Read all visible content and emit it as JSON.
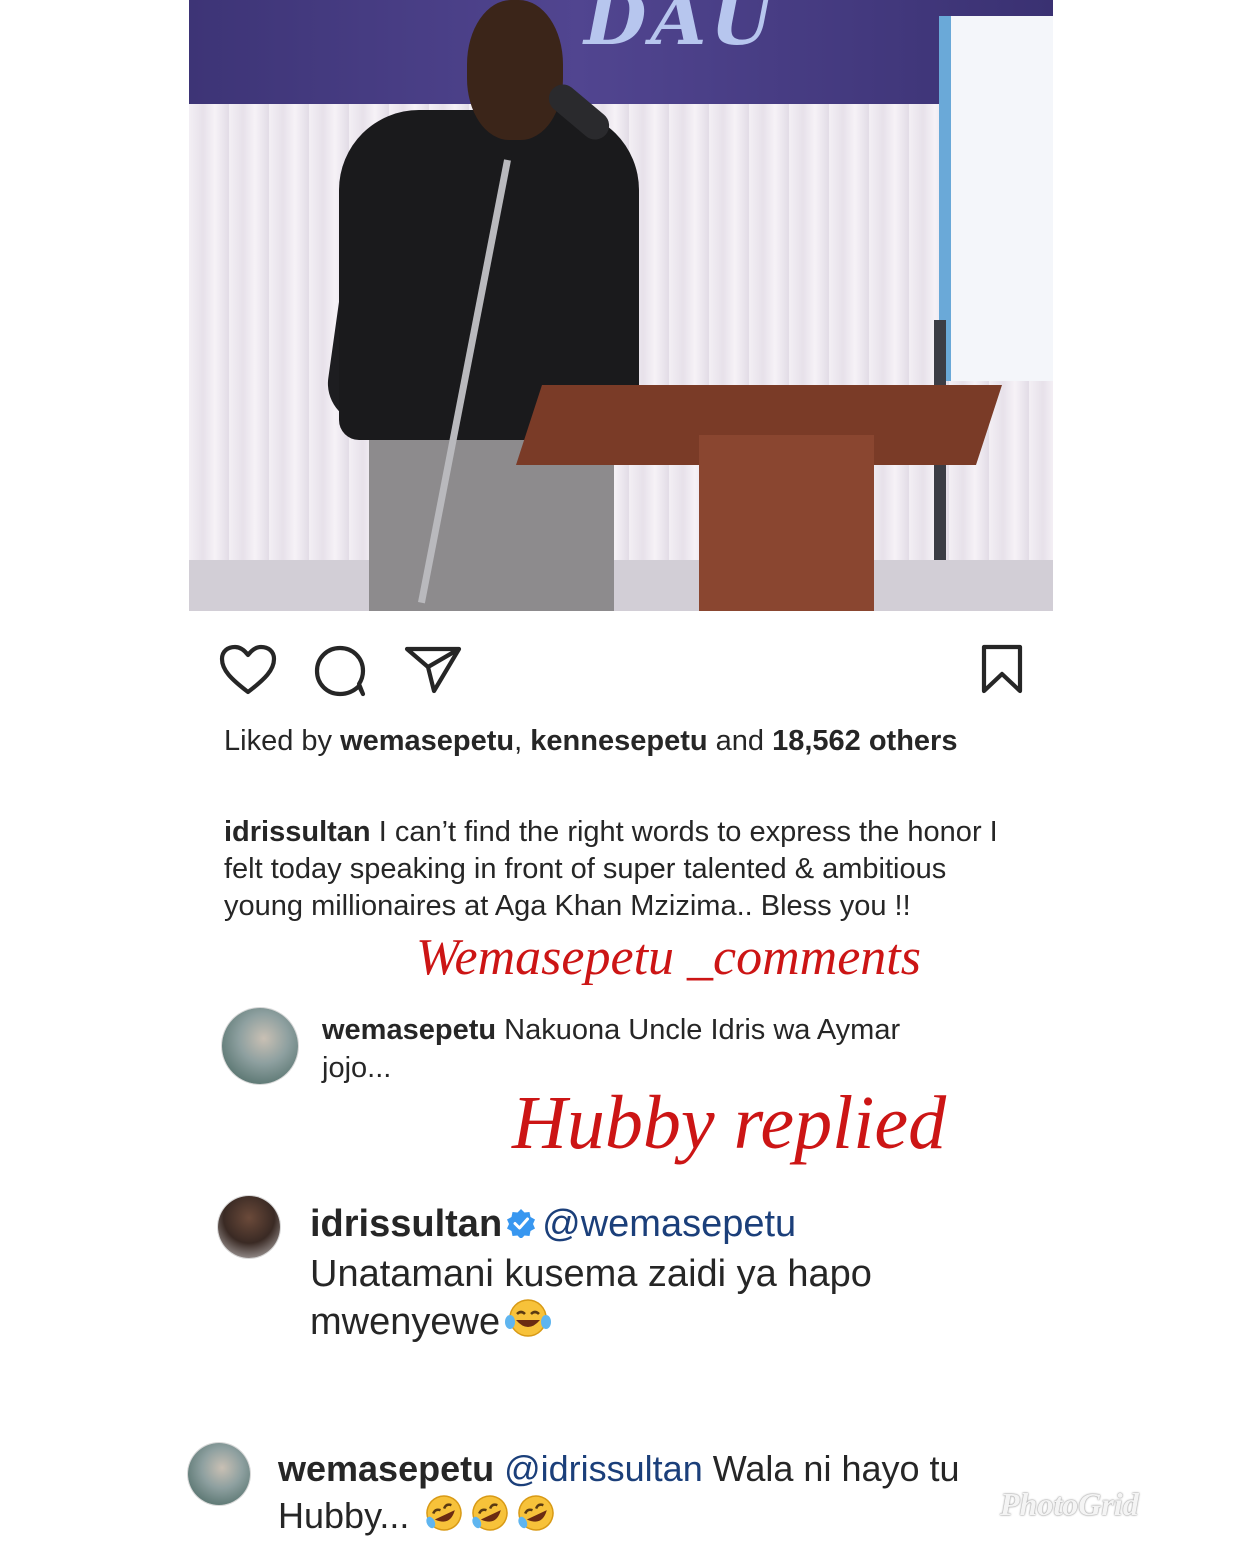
{
  "post": {
    "likes_prefix": "Liked by ",
    "liker_1": "wemasepetu",
    "separator": ", ",
    "liker_2": "kennesepetu",
    "likes_and": " and ",
    "likes_count": "18,562",
    "likes_suffix": " others"
  },
  "caption": {
    "username": "idrissultan",
    "text": " I can’t find the right words to express the honor I felt today speaking in front of super talented & ambitious young millionaires at Aga Khan Mzizima.. Bless you !!"
  },
  "overlays": {
    "label_1": "Wemasepetu _comments",
    "label_2": "Hubby replied"
  },
  "comments": [
    {
      "username": "wemasepetu",
      "text": " Nakuona Uncle Idris wa Aymar jojo..."
    },
    {
      "username": "idrissultan",
      "mention": "@wemasepetu",
      "text": "Unatamani kusema zaidi ya hapo mwenyewe"
    },
    {
      "username": "wemasepetu",
      "mention": "@idrissultan",
      "text": " Wala ni hayo tu Hubby..."
    }
  ],
  "watermark": "PhotoGrid",
  "icons": {
    "like": "heart-icon",
    "comment": "comment-icon",
    "share": "send-icon",
    "save": "bookmark-icon",
    "verified": "verified-badge-icon",
    "laugh": "tears-of-joy-emoji",
    "rofl": "rolling-laughing-emoji"
  },
  "colors": {
    "text": "#262626",
    "overlay_red": "#cc1515",
    "mention": "#1b3f7a",
    "verified_blue": "#3897f0"
  }
}
